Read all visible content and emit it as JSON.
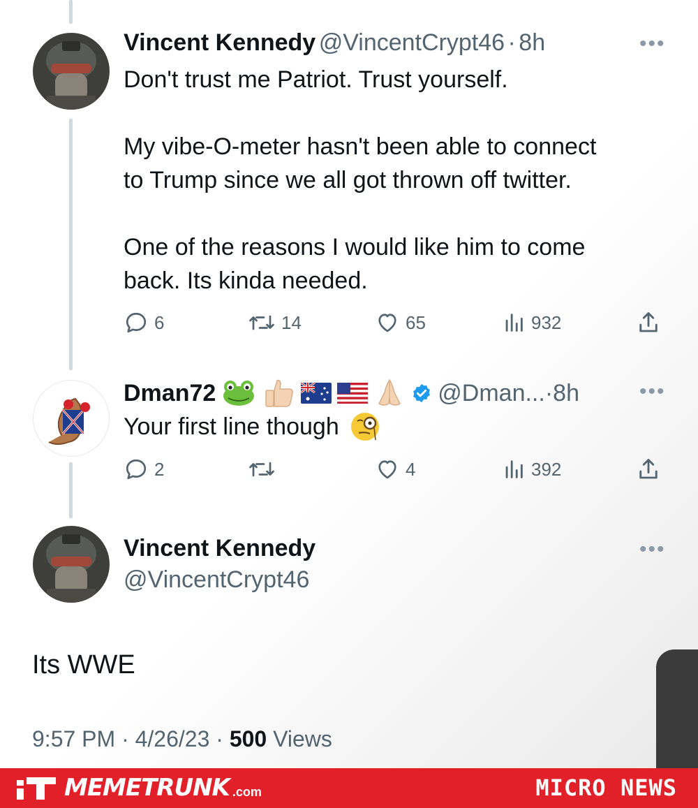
{
  "tweets": [
    {
      "name": "Vincent Kennedy",
      "handle": "@VincentCrypt46",
      "time": "8h",
      "text_lines": [
        "Don't trust me Patriot. Trust yourself.",
        "",
        "My vibe-O-meter hasn't been able to connect",
        "to Trump since we all got thrown off twitter.",
        "",
        "One of the reasons I would like him to come",
        "back. Its kinda needed."
      ],
      "replies": "6",
      "retweets": "14",
      "likes": "65",
      "views": "932"
    },
    {
      "name": "Dman72",
      "handle": "@Dman...",
      "time": "8h",
      "emojis": [
        "frog-emoji",
        "thumbs-up-emoji",
        "australia-flag-emoji",
        "usa-flag-emoji",
        "praying-hands-emoji",
        "verified-badge-icon"
      ],
      "text": "Your first line though",
      "text_emoji": "monocle-face-emoji",
      "replies": "2",
      "retweets": "",
      "likes": "4",
      "views": "392"
    }
  ],
  "main_tweet": {
    "name": "Vincent Kennedy",
    "handle": "@VincentCrypt46",
    "text": "Its WWE",
    "time": "9:57 PM",
    "date": "4/26/23",
    "views_count": "500",
    "views_label": "Views"
  },
  "separator": "·",
  "more_label": "•••",
  "footer": {
    "brand_name": "MEMETRUNK",
    "brand_domain": ".com",
    "tagline": "MICRO NEWS",
    "brand_color": "#e2202a"
  },
  "colors": {
    "text": "#0f1419",
    "muted": "#536471",
    "verified": "#1d9bf0",
    "thread_line": "#cfd9de"
  }
}
